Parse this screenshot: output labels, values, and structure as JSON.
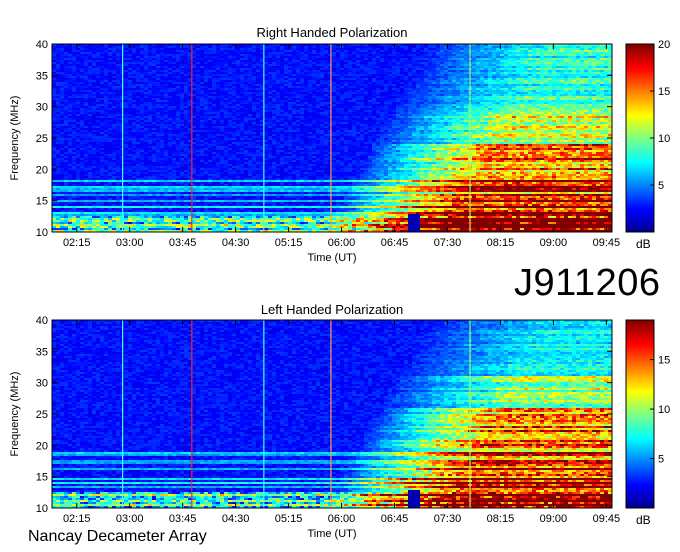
{
  "observation_id": "J911206",
  "footer": "Nancay Decameter Array",
  "chart_data": [
    {
      "type": "heatmap",
      "title": "Right Handed Polarization",
      "xlabel": "Time (UT)",
      "ylabel": "Frequency (MHz)",
      "x_ticks": [
        "02:15",
        "03:00",
        "03:45",
        "04:30",
        "05:15",
        "06:00",
        "06:45",
        "07:30",
        "08:15",
        "09:00",
        "09:45"
      ],
      "y_ticks": [
        10,
        15,
        20,
        25,
        30,
        35,
        40
      ],
      "ylim": [
        10,
        40
      ],
      "colorbar": {
        "label": "dB",
        "ticks": [
          5,
          10,
          15,
          20
        ],
        "range": [
          0,
          20
        ]
      },
      "colorscale": "jet",
      "features": [
        {
          "description_time_start": "06:00",
          "description_time_end": "09:50",
          "freq_low": 10,
          "freq_high": 40,
          "level_db": "rising"
        }
      ]
    },
    {
      "type": "heatmap",
      "title": "Left Handed Polarization",
      "xlabel": "Time (UT)",
      "ylabel": "Frequency (MHz)",
      "x_ticks": [
        "02:15",
        "03:00",
        "03:45",
        "04:30",
        "05:15",
        "06:00",
        "06:45",
        "07:30",
        "08:15",
        "09:00",
        "09:45"
      ],
      "y_ticks": [
        10,
        15,
        20,
        25,
        30,
        35,
        40
      ],
      "ylim": [
        10,
        40
      ],
      "colorbar": {
        "label": "dB",
        "ticks": [
          5,
          10,
          15
        ],
        "range": [
          0,
          19
        ]
      },
      "colorscale": "jet"
    }
  ]
}
